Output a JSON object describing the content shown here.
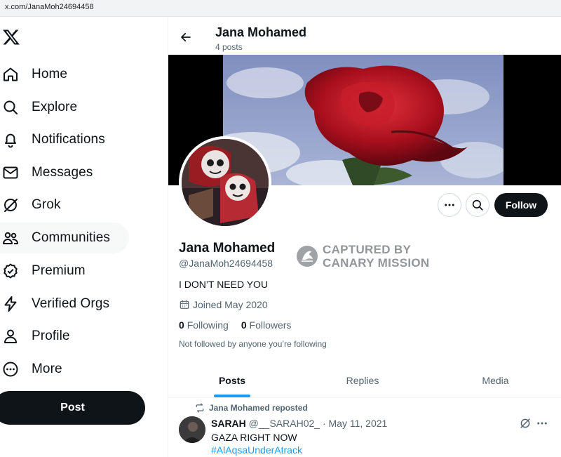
{
  "browser": {
    "url": "x.com/JanaMoh24694458"
  },
  "sidebar": {
    "logo_icon": "x-logo-icon",
    "items": [
      {
        "label": "Home",
        "icon": "home-icon"
      },
      {
        "label": "Explore",
        "icon": "search-icon"
      },
      {
        "label": "Notifications",
        "icon": "bell-icon"
      },
      {
        "label": "Messages",
        "icon": "envelope-icon"
      },
      {
        "label": "Grok",
        "icon": "grok-icon"
      },
      {
        "label": "Communities",
        "icon": "communities-icon"
      },
      {
        "label": "Premium",
        "icon": "verified-badge-icon"
      },
      {
        "label": "Verified Orgs",
        "icon": "lightning-icon"
      },
      {
        "label": "Profile",
        "icon": "person-icon"
      },
      {
        "label": "More",
        "icon": "more-circle-icon"
      }
    ],
    "post_label": "Post"
  },
  "header": {
    "name": "Jana Mohamed",
    "post_count": "4 posts"
  },
  "profile": {
    "name": "Jana Mohamed",
    "handle": "@JanaMoh24694458",
    "bio": "I DON’T NEED YOU",
    "joined": "Joined May 2020",
    "following_count": "0",
    "following_label": "Following",
    "followers_count": "0",
    "followers_label": "Followers",
    "note": "Not followed by anyone you’re following",
    "follow_label": "Follow"
  },
  "watermark": {
    "line1": "CAPTURED BY",
    "line2": "CANARY MISSION"
  },
  "tabs": [
    {
      "label": "Posts",
      "active": true
    },
    {
      "label": "Replies",
      "active": false
    },
    {
      "label": "Media",
      "active": false
    }
  ],
  "tweet": {
    "repost_text": "Jana Mohamed reposted",
    "author_name": "SARAH",
    "author_handle": "@__SARAH02_",
    "separator": "·",
    "date": "May 11, 2021",
    "text": "GAZA RIGHT NOW",
    "hashtag": "#AlAqsaUnderAtrack"
  },
  "colors": {
    "accent": "#1d9bf0",
    "text": "#0f1419",
    "muted": "#536471",
    "button_dark": "#0f1419"
  }
}
